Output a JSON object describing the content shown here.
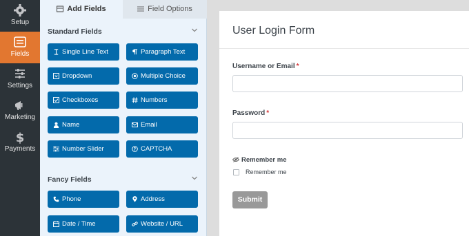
{
  "nav": {
    "items": [
      {
        "label": "Setup",
        "icon": "gear-icon"
      },
      {
        "label": "Fields",
        "icon": "fields-list-icon",
        "active": true
      },
      {
        "label": "Settings",
        "icon": "sliders-icon"
      },
      {
        "label": "Marketing",
        "icon": "megaphone-icon"
      },
      {
        "label": "Payments",
        "icon": "dollar-icon"
      }
    ]
  },
  "tabs": {
    "add_fields": "Add Fields",
    "field_options": "Field Options"
  },
  "standard": {
    "title": "Standard Fields",
    "fields": [
      {
        "label": "Single Line Text",
        "icon": "text-cursor-icon"
      },
      {
        "label": "Paragraph Text",
        "icon": "paragraph-icon"
      },
      {
        "label": "Dropdown",
        "icon": "dropdown-icon"
      },
      {
        "label": "Multiple Choice",
        "icon": "radio-icon"
      },
      {
        "label": "Checkboxes",
        "icon": "checkbox-icon"
      },
      {
        "label": "Numbers",
        "icon": "hash-icon"
      },
      {
        "label": "Name",
        "icon": "user-icon"
      },
      {
        "label": "Email",
        "icon": "envelope-icon"
      },
      {
        "label": "Number Slider",
        "icon": "slider-icon"
      },
      {
        "label": "CAPTCHA",
        "icon": "captcha-icon"
      }
    ]
  },
  "fancy": {
    "title": "Fancy Fields",
    "fields": [
      {
        "label": "Phone",
        "icon": "phone-icon"
      },
      {
        "label": "Address",
        "icon": "map-pin-icon"
      },
      {
        "label": "Date / Time",
        "icon": "calendar-icon"
      },
      {
        "label": "Website / URL",
        "icon": "link-icon"
      }
    ]
  },
  "form": {
    "title": "User Login Form",
    "username_label": "Username or Email",
    "password_label": "Password",
    "required_mark": "*",
    "remember_heading": "Remember me",
    "remember_option": "Remember me",
    "submit_label": "Submit"
  },
  "colors": {
    "nav_bg": "#2c3338",
    "nav_active": "#e27730",
    "field_button": "#036aab",
    "panel_bg": "#ebf3fb",
    "submit_bg": "#999999",
    "required": "#d63638"
  }
}
